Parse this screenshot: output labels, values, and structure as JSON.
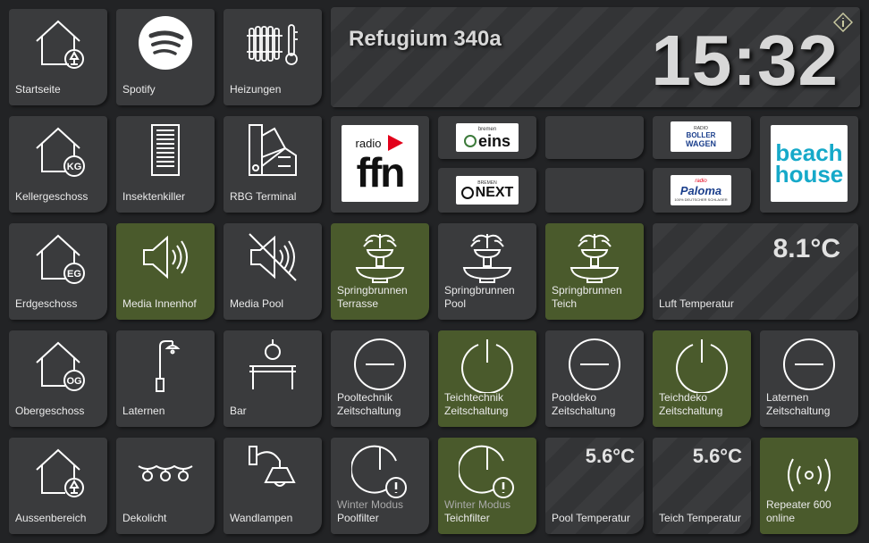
{
  "header": {
    "title": "Refugium 340a",
    "clock": "15:32"
  },
  "tiles": {
    "startseite": "Startseite",
    "spotify": "Spotify",
    "heizungen": "Heizungen",
    "kellergeschoss": "Kellergeschoss",
    "insektenkiller": "Insektenkiller",
    "rbg_terminal": "RBG Terminal",
    "erdgeschoss": "Erdgeschoss",
    "media_innenhof": "Media Innenhof",
    "media_pool": "Media Pool",
    "sb_terrasse": [
      "Springbrunnen",
      "Terrasse"
    ],
    "sb_pool": [
      "Springbrunnen",
      "Pool"
    ],
    "sb_teich": [
      "Springbrunnen",
      "Teich"
    ],
    "luft_temp": {
      "label": "Luft Temperatur",
      "value": "8.1°C"
    },
    "obergeschoss": "Obergeschoss",
    "laternen": "Laternen",
    "bar": "Bar",
    "pooltechnik": [
      "Pooltechnik",
      "Zeitschaltung"
    ],
    "teichtechnik": [
      "Teichtechnik",
      "Zeitschaltung"
    ],
    "pooldeko": [
      "Pooldeko",
      "Zeitschaltung"
    ],
    "teichdeko": [
      "Teichdeko",
      "Zeitschaltung"
    ],
    "laternen_zeit": [
      "Laternen",
      "Zeitschaltung"
    ],
    "aussenbereich": "Aussenbereich",
    "dekolicht": "Dekolicht",
    "wandlampen": "Wandlampen",
    "winter_pool": [
      "Winter Modus",
      "Poolfilter"
    ],
    "winter_teich": [
      "Winter Modus",
      "Teichfilter"
    ],
    "pool_temp": {
      "label": "Pool Temperatur",
      "value": "5.6°C"
    },
    "teich_temp": {
      "label": "Teich Temperatur",
      "value": "5.6°C"
    },
    "repeater": [
      "Repeater 600",
      "online"
    ]
  },
  "house_badges": {
    "kg": "KG",
    "eg": "EG",
    "og": "OG"
  },
  "radio": {
    "ffn": {
      "top": "radio",
      "main": "ffn"
    },
    "bremen_eins": {
      "small": "bremen",
      "main": "eins"
    },
    "bremen_next": {
      "small": "BREMEN",
      "main": "NEXT"
    },
    "boller": {
      "top": "RADIO",
      "main": [
        "BOLLER",
        "WAGEN"
      ]
    },
    "paloma": {
      "top": "radio",
      "main": "Paloma",
      "sub": "100% DEUTSCHER SCHLAGER"
    },
    "beach": [
      "beach",
      "house"
    ]
  },
  "colors": {
    "tile": "#3a3b3d",
    "active": "#4a5a2c",
    "background": "#222325"
  }
}
